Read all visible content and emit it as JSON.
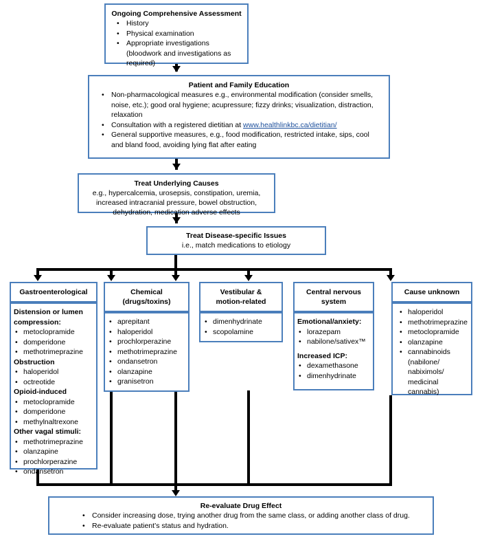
{
  "theme": {
    "border_color": "#4A7EBB",
    "connector_color": "#000000",
    "link_color": "#1B4E9B",
    "background": "#FFFFFF"
  },
  "flow": {
    "assessment": {
      "title": "Ongoing Comprehensive Assessment",
      "items": [
        "History",
        "Physical examination",
        "Appropriate investigations (bloodwork and investigations as required)"
      ]
    },
    "education": {
      "title": "Patient and  Family Education",
      "items": [
        "Non-pharmacological measures e.g., environmental modification (consider smells, noise, etc.); good oral hygiene; acupressure; fizzy drinks; visualization, distraction, relaxation",
        "Consultation with a registered dietitian at ",
        "General supportive measures, e.g., food modification, restricted intake, sips, cool and bland food, avoiding lying flat after eating"
      ],
      "link_text": "www.healthlinkbc.ca/dietitian/"
    },
    "underlying_causes": {
      "title": "Treat Underlying Causes",
      "text": "e.g., hypercalcemia, urosepsis, constipation, uremia, increased intracranial pressure, bowel obstruction, dehydration, medication adverse effects"
    },
    "disease_specific": {
      "title": "Treat Disease-specific Issues",
      "text": "i.e., match medications to etiology"
    },
    "reevaluate": {
      "title": "Re-evaluate Drug Effect",
      "items": [
        "Consider increasing dose, trying another drug from the same class, or adding another class of drug.",
        "Re-evaluate patient’s status and hydration."
      ]
    }
  },
  "columns": [
    {
      "id": "gastroenterological",
      "header_line1": "Gastroenterological",
      "header_line2": "",
      "groups": [
        {
          "label": "Distension or lumen compression:",
          "drugs": [
            "metoclopramide",
            "domperidone",
            "methotrimeprazine"
          ]
        },
        {
          "label": "Obstruction",
          "drugs": [
            "haloperidol",
            "octreotide"
          ]
        },
        {
          "label": "Opioid-induced",
          "drugs": [
            "metoclopramide",
            "domperidone",
            "methylnaltrexone"
          ]
        },
        {
          "label": "Other vagal stimuli:",
          "drugs": [
            "methotrimeprazine",
            "olanzapine",
            "prochlorperazine",
            "ondansetron"
          ]
        }
      ]
    },
    {
      "id": "chemical",
      "header_line1": "Chemical",
      "header_line2": "(drugs/toxins)",
      "groups": [
        {
          "label": "",
          "drugs": [
            "aprepitant",
            "haloperidol",
            "prochlorperazine",
            "methotrimeprazine",
            "ondansetron",
            "olanzapine",
            "granisetron"
          ]
        }
      ]
    },
    {
      "id": "vestibular",
      "header_line1": "Vestibular &",
      "header_line2": "motion-related",
      "groups": [
        {
          "label": "",
          "drugs": [
            "dimenhydrinate",
            "scopolamine"
          ]
        }
      ]
    },
    {
      "id": "central-nervous-system",
      "header_line1": "Central nervous",
      "header_line2": "system",
      "groups": [
        {
          "label": "Emotional/anxiety:",
          "drugs": [
            "lorazepam",
            "nabilone/sativex™"
          ]
        },
        {
          "label": "Increased ICP:",
          "drugs": [
            "dexamethasone",
            "dimenhydrinate"
          ]
        }
      ]
    },
    {
      "id": "cause-unknown",
      "header_line1": "Cause unknown",
      "header_line2": "",
      "groups": [
        {
          "label": "",
          "drugs": [
            "haloperidol",
            "methotrimeprazine",
            "metoclopramide",
            "olanzapine",
            "cannabinoids (nabilone/ nabiximols/ medicinal cannabis)"
          ]
        }
      ]
    }
  ]
}
